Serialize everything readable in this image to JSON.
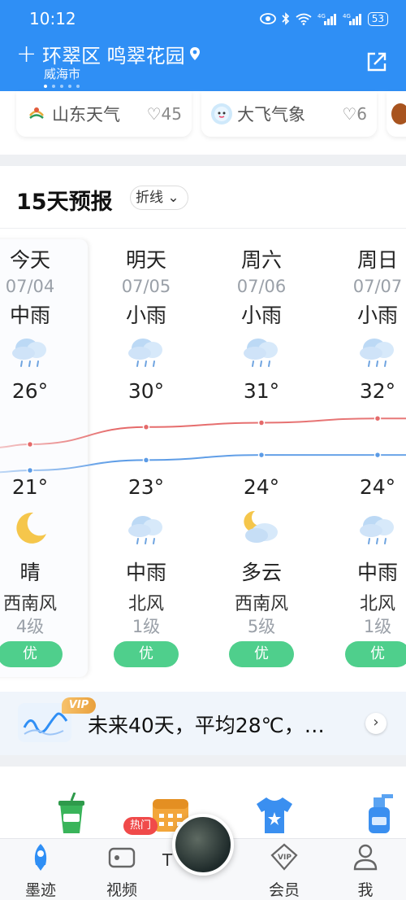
{
  "status": {
    "time": "10:12",
    "battery": "53"
  },
  "header": {
    "location_title": "环翠区 鸣翠花园",
    "location_sub": "威海市"
  },
  "sources": [
    {
      "name": "山东天气",
      "likes": "45"
    },
    {
      "name": "大飞气象",
      "likes": "6"
    }
  ],
  "forecast": {
    "title": "15天预报",
    "mode": "折线",
    "days": [
      {
        "name": "今天",
        "date": "07/04",
        "cond_day": "中雨",
        "hi": "26°",
        "lo": "21°",
        "cond_night": "晴",
        "wind": "西南风",
        "level": "4级",
        "aqi": "优",
        "icon_day": "rain-cloud-icon",
        "icon_night": "moon-icon"
      },
      {
        "name": "明天",
        "date": "07/05",
        "cond_day": "小雨",
        "hi": "30°",
        "lo": "23°",
        "cond_night": "中雨",
        "wind": "北风",
        "level": "1级",
        "aqi": "优",
        "icon_day": "rain-cloud-icon",
        "icon_night": "rain-cloud-icon"
      },
      {
        "name": "周六",
        "date": "07/06",
        "cond_day": "小雨",
        "hi": "31°",
        "lo": "24°",
        "cond_night": "多云",
        "wind": "西南风",
        "level": "5级",
        "aqi": "优",
        "icon_day": "rain-cloud-icon",
        "icon_night": "moon-cloud-icon"
      },
      {
        "name": "周日",
        "date": "07/07",
        "cond_day": "小雨",
        "hi": "32°",
        "lo": "24°",
        "cond_night": "中雨",
        "wind": "北风",
        "level": "1级",
        "aqi": "优",
        "icon_day": "rain-cloud-icon",
        "icon_night": "rain-cloud-icon"
      }
    ],
    "high_values": [
      26,
      30,
      31,
      32
    ],
    "low_values": [
      21,
      23,
      24,
      24
    ],
    "high_color": "#e56a6a",
    "low_color": "#5b9be6",
    "aqi_color": "#4fcf8c"
  },
  "banner": {
    "vip": "VIP",
    "text": "未来40天，平均28℃，…"
  },
  "nav": {
    "items": [
      "墨迹",
      "视频",
      "",
      "会员",
      "我"
    ],
    "hot_badge": "热门",
    "partial_label": "T"
  },
  "tools": [
    "drink-cup-icon",
    "calendar-icon",
    "tshirt-icon",
    "sunscreen-icon"
  ],
  "colors": {
    "brand": "#2f8ff5"
  }
}
